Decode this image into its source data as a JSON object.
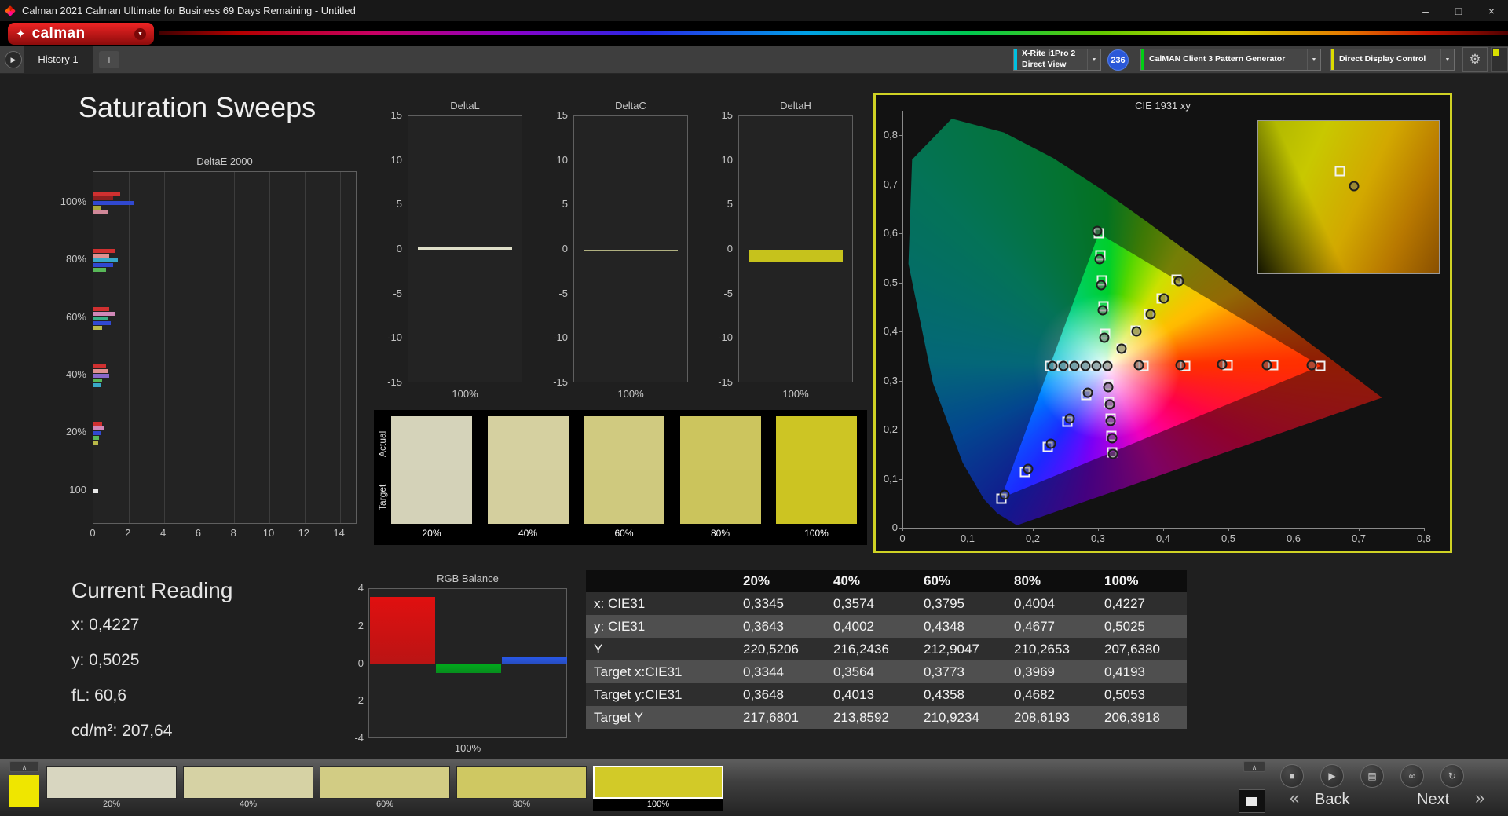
{
  "window": {
    "title": "Calman 2021 Calman Ultimate for Business 69 Days Remaining  - Untitled"
  },
  "icons": {
    "minimize": "–",
    "restore": "□",
    "close": "×",
    "caret_down": "▼",
    "caret_down_small": "▼",
    "chevron_up": "∧",
    "back_chevron": "«",
    "next_chevron": "»",
    "plus": "+",
    "panel_arrow": "▶",
    "gear": "⚙",
    "logo_flower": "✦"
  },
  "brand": {
    "logo_text": "calman"
  },
  "nav": {
    "history_tab": "History 1"
  },
  "devices": {
    "meter": {
      "line1": "X-Rite i1Pro 2",
      "line2": "Direct View",
      "accent": "#00c0e0"
    },
    "badge": "236",
    "pattern_generator": {
      "label": "CalMAN Client 3 Pattern Generator",
      "accent": "#00d014"
    },
    "display_control": {
      "label": "Direct Display Control",
      "accent": "#dcdc00"
    }
  },
  "page": {
    "title": "Saturation Sweeps"
  },
  "current_reading": {
    "title": "Current Reading",
    "lines": [
      "x: 0,4227",
      "y: 0,5025",
      "fL: 60,6",
      "cd/m²: 207,64"
    ]
  },
  "swatch_strip": {
    "row_labels": [
      "Actual",
      "Target"
    ],
    "items": [
      {
        "label": "20%",
        "actual": "#d5d3ba",
        "target": "#d4d2b8"
      },
      {
        "label": "40%",
        "actual": "#d5d0a0",
        "target": "#d4cf9e"
      },
      {
        "label": "60%",
        "actual": "#d0ca80",
        "target": "#cfc97e"
      },
      {
        "label": "80%",
        "actual": "#ccc55e",
        "target": "#cbc45c"
      },
      {
        "label": "100%",
        "actual": "#cdc524",
        "target": "#ccc422"
      }
    ]
  },
  "chart_data": [
    {
      "id": "deltae2000",
      "type": "bar",
      "title": "DeltaE 2000",
      "orientation": "horizontal",
      "xlim": [
        0,
        15
      ],
      "x_ticks": [
        0,
        2,
        4,
        6,
        8,
        10,
        12,
        14
      ],
      "groups": [
        {
          "label": "100%",
          "bars": [
            {
              "color": "#d03030",
              "value": 1.5
            },
            {
              "color": "#8c2020",
              "value": 1.1
            },
            {
              "color": "#3048d0",
              "value": 2.3
            },
            {
              "color": "#a8a838",
              "value": 0.4
            },
            {
              "color": "#d08898",
              "value": 0.8
            }
          ]
        },
        {
          "label": "80%",
          "bars": [
            {
              "color": "#d03030",
              "value": 1.2
            },
            {
              "color": "#e09090",
              "value": 0.9
            },
            {
              "color": "#38a8c8",
              "value": 1.4
            },
            {
              "color": "#3048d0",
              "value": 1.1
            },
            {
              "color": "#58b858",
              "value": 0.7
            }
          ]
        },
        {
          "label": "60%",
          "bars": [
            {
              "color": "#d03030",
              "value": 0.9
            },
            {
              "color": "#d088b8",
              "value": 1.2
            },
            {
              "color": "#38b088",
              "value": 0.8
            },
            {
              "color": "#3048d0",
              "value": 1.0
            },
            {
              "color": "#b8b848",
              "value": 0.5
            }
          ]
        },
        {
          "label": "40%",
          "bars": [
            {
              "color": "#d03030",
              "value": 0.7
            },
            {
              "color": "#e09090",
              "value": 0.8
            },
            {
              "color": "#8868c8",
              "value": 0.9
            },
            {
              "color": "#58b858",
              "value": 0.5
            },
            {
              "color": "#38a8c8",
              "value": 0.4
            }
          ]
        },
        {
          "label": "20%",
          "bars": [
            {
              "color": "#d03030",
              "value": 0.5
            },
            {
              "color": "#d088b8",
              "value": 0.6
            },
            {
              "color": "#3048d0",
              "value": 0.45
            },
            {
              "color": "#58b858",
              "value": 0.3
            },
            {
              "color": "#b8b848",
              "value": 0.25
            }
          ]
        },
        {
          "label": "100",
          "bars": [
            {
              "color": "#e8e8e8",
              "value": 0.25
            }
          ]
        }
      ]
    },
    {
      "id": "deltaL",
      "type": "bar",
      "title": "DeltaL",
      "ylim": [
        -15,
        15
      ],
      "y_ticks": [
        "15",
        "10",
        "5",
        "0",
        "-5",
        "-10",
        "-15"
      ],
      "x_label": "100%",
      "value": 0.3,
      "color": "#dedec8"
    },
    {
      "id": "deltaC",
      "type": "bar",
      "title": "DeltaC",
      "ylim": [
        -15,
        15
      ],
      "y_ticks": [
        "15",
        "10",
        "5",
        "0",
        "-5",
        "-10",
        "-15"
      ],
      "x_label": "100%",
      "value": -0.2,
      "color": "#b0b080"
    },
    {
      "id": "deltaH",
      "type": "bar",
      "title": "DeltaH",
      "ylim": [
        -15,
        15
      ],
      "y_ticks": [
        "15",
        "10",
        "5",
        "0",
        "-5",
        "-10",
        "-15"
      ],
      "x_label": "100%",
      "value": -1.3,
      "color": "#c6c21c"
    },
    {
      "id": "cie1931",
      "type": "scatter",
      "title": "CIE 1931 xy",
      "xlim": [
        0,
        0.8
      ],
      "ylim": [
        0,
        0.85
      ],
      "x_tick_labels": [
        "0",
        "0,1",
        "0,2",
        "0,3",
        "0,4",
        "0,5",
        "0,6",
        "0,7",
        "0,8"
      ],
      "y_tick_labels": [
        "0",
        "0,1",
        "0,2",
        "0,3",
        "0,4",
        "0,5",
        "0,6",
        "0,7",
        "0,8"
      ],
      "white_point": [
        0.3127,
        0.329
      ],
      "sweeps": [
        {
          "name": "red",
          "targets": [
            [
              0.369,
              0.33
            ],
            [
              0.432,
              0.33
            ],
            [
              0.497,
              0.331
            ],
            [
              0.567,
              0.331
            ],
            [
              0.64,
              0.33
            ]
          ],
          "measured": [
            [
              0.362,
              0.331
            ],
            [
              0.425,
              0.332
            ],
            [
              0.489,
              0.333
            ],
            [
              0.558,
              0.332
            ],
            [
              0.627,
              0.331
            ]
          ]
        },
        {
          "name": "green",
          "targets": [
            [
              0.31,
              0.395
            ],
            [
              0.307,
              0.452
            ],
            [
              0.305,
              0.505
            ],
            [
              0.302,
              0.555
            ],
            [
              0.3,
              0.6
            ]
          ],
          "measured": [
            [
              0.309,
              0.388
            ],
            [
              0.306,
              0.443
            ],
            [
              0.304,
              0.495
            ],
            [
              0.301,
              0.547
            ],
            [
              0.297,
              0.605
            ]
          ]
        },
        {
          "name": "blue",
          "targets": [
            [
              0.281,
              0.27
            ],
            [
              0.252,
              0.216
            ],
            [
              0.222,
              0.165
            ],
            [
              0.187,
              0.113
            ],
            [
              0.15,
              0.06
            ]
          ],
          "measured": [
            [
              0.283,
              0.275
            ],
            [
              0.255,
              0.222
            ],
            [
              0.226,
              0.171
            ],
            [
              0.192,
              0.12
            ],
            [
              0.155,
              0.068
            ]
          ]
        },
        {
          "name": "cyan",
          "targets": [
            [
              0.295,
              0.329
            ],
            [
              0.278,
              0.329
            ],
            [
              0.261,
              0.329
            ],
            [
              0.243,
              0.329
            ],
            [
              0.225,
              0.329
            ]
          ],
          "measured": [
            [
              0.296,
              0.33
            ],
            [
              0.28,
              0.33
            ],
            [
              0.263,
              0.33
            ],
            [
              0.246,
              0.33
            ],
            [
              0.229,
              0.33
            ]
          ]
        },
        {
          "name": "magenta",
          "targets": [
            [
              0.3145,
              0.291
            ],
            [
              0.316,
              0.256
            ],
            [
              0.318,
              0.222
            ],
            [
              0.319,
              0.188
            ],
            [
              0.321,
              0.154
            ]
          ],
          "measured": [
            [
              0.315,
              0.286
            ],
            [
              0.3165,
              0.251
            ],
            [
              0.3185,
              0.217
            ],
            [
              0.32,
              0.183
            ],
            [
              0.322,
              0.15
            ]
          ]
        },
        {
          "name": "yellow",
          "targets": [
            [
              0.3344,
              0.3648
            ],
            [
              0.3564,
              0.4013
            ],
            [
              0.3773,
              0.4358
            ],
            [
              0.3969,
              0.4682
            ],
            [
              0.4193,
              0.5053
            ]
          ],
          "measured": [
            [
              0.3345,
              0.3643
            ],
            [
              0.3574,
              0.4002
            ],
            [
              0.3795,
              0.4348
            ],
            [
              0.4004,
              0.4677
            ],
            [
              0.4227,
              0.5025
            ]
          ]
        }
      ]
    },
    {
      "id": "rgb_balance",
      "type": "bar",
      "title": "RGB Balance",
      "ylim": [
        -4,
        4
      ],
      "y_ticks": [
        "4",
        "2",
        "0",
        "-2",
        "-4"
      ],
      "x_label": "100%",
      "series": [
        {
          "name": "red",
          "value": 3.6,
          "color": "#e01010"
        },
        {
          "name": "green",
          "value": -0.5,
          "color": "#00a81c"
        },
        {
          "name": "blue",
          "value": 0.35,
          "color": "#2858e8"
        }
      ]
    },
    {
      "id": "measurement_table",
      "type": "table",
      "columns": [
        "",
        "20%",
        "40%",
        "60%",
        "80%",
        "100%"
      ],
      "rows": [
        {
          "label": "x: CIE31",
          "values": [
            "0,3345",
            "0,3574",
            "0,3795",
            "0,4004",
            "0,4227"
          ]
        },
        {
          "label": "y: CIE31",
          "values": [
            "0,3643",
            "0,4002",
            "0,4348",
            "0,4677",
            "0,5025"
          ]
        },
        {
          "label": "Y",
          "values": [
            "220,5206",
            "216,2436",
            "212,9047",
            "210,2653",
            "207,6380"
          ]
        },
        {
          "label": "Target x:CIE31",
          "values": [
            "0,3344",
            "0,3564",
            "0,3773",
            "0,3969",
            "0,4193"
          ]
        },
        {
          "label": "Target y:CIE31",
          "values": [
            "0,3648",
            "0,4013",
            "0,4358",
            "0,4682",
            "0,5053"
          ]
        },
        {
          "label": "Target Y",
          "values": [
            "217,6801",
            "213,8592",
            "210,9234",
            "208,6193",
            "206,3918"
          ]
        }
      ]
    }
  ],
  "bottom_bar": {
    "current_color": "#efe600",
    "active_index": 4,
    "patches": [
      {
        "label": "20%",
        "color": "#d8d6c0"
      },
      {
        "label": "40%",
        "color": "#d6d2a4"
      },
      {
        "label": "60%",
        "color": "#d2cc84"
      },
      {
        "label": "80%",
        "color": "#cfc862"
      },
      {
        "label": "100%",
        "color": "#d2ca28"
      }
    ],
    "round_buttons": [
      {
        "name": "stop-button",
        "glyph": "■"
      },
      {
        "name": "play-button",
        "glyph": "▶"
      },
      {
        "name": "save-button",
        "glyph": "▤"
      },
      {
        "name": "loop-button",
        "glyph": "∞"
      },
      {
        "name": "refresh-button",
        "glyph": "↻"
      }
    ],
    "back_label": "Back",
    "next_label": "Next"
  }
}
